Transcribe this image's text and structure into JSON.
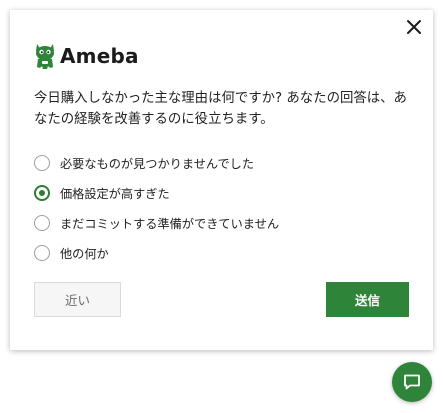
{
  "dialog": {
    "brand": "Ameba",
    "question": "今日購入しなかった主な理由は何ですか? あなたの回答は、あなたの経験を改善するのに役立ちます。",
    "options": [
      {
        "label": "必要なものが見つかりませんでした",
        "selected": false
      },
      {
        "label": "価格設定が高すぎた",
        "selected": true
      },
      {
        "label": "まだコミットする準備ができていません",
        "selected": false
      },
      {
        "label": "他の何か",
        "selected": false
      }
    ],
    "close_button_label": "近い",
    "send_button_label": "送信"
  },
  "icons": {
    "close": "close-icon",
    "logo": "ameba-logo-icon",
    "chat": "chat-icon"
  },
  "colors": {
    "accent": "#2e8539",
    "radio_selected": "#2e7d32",
    "radio_border": "#9e9e9e",
    "text": "#222222"
  }
}
